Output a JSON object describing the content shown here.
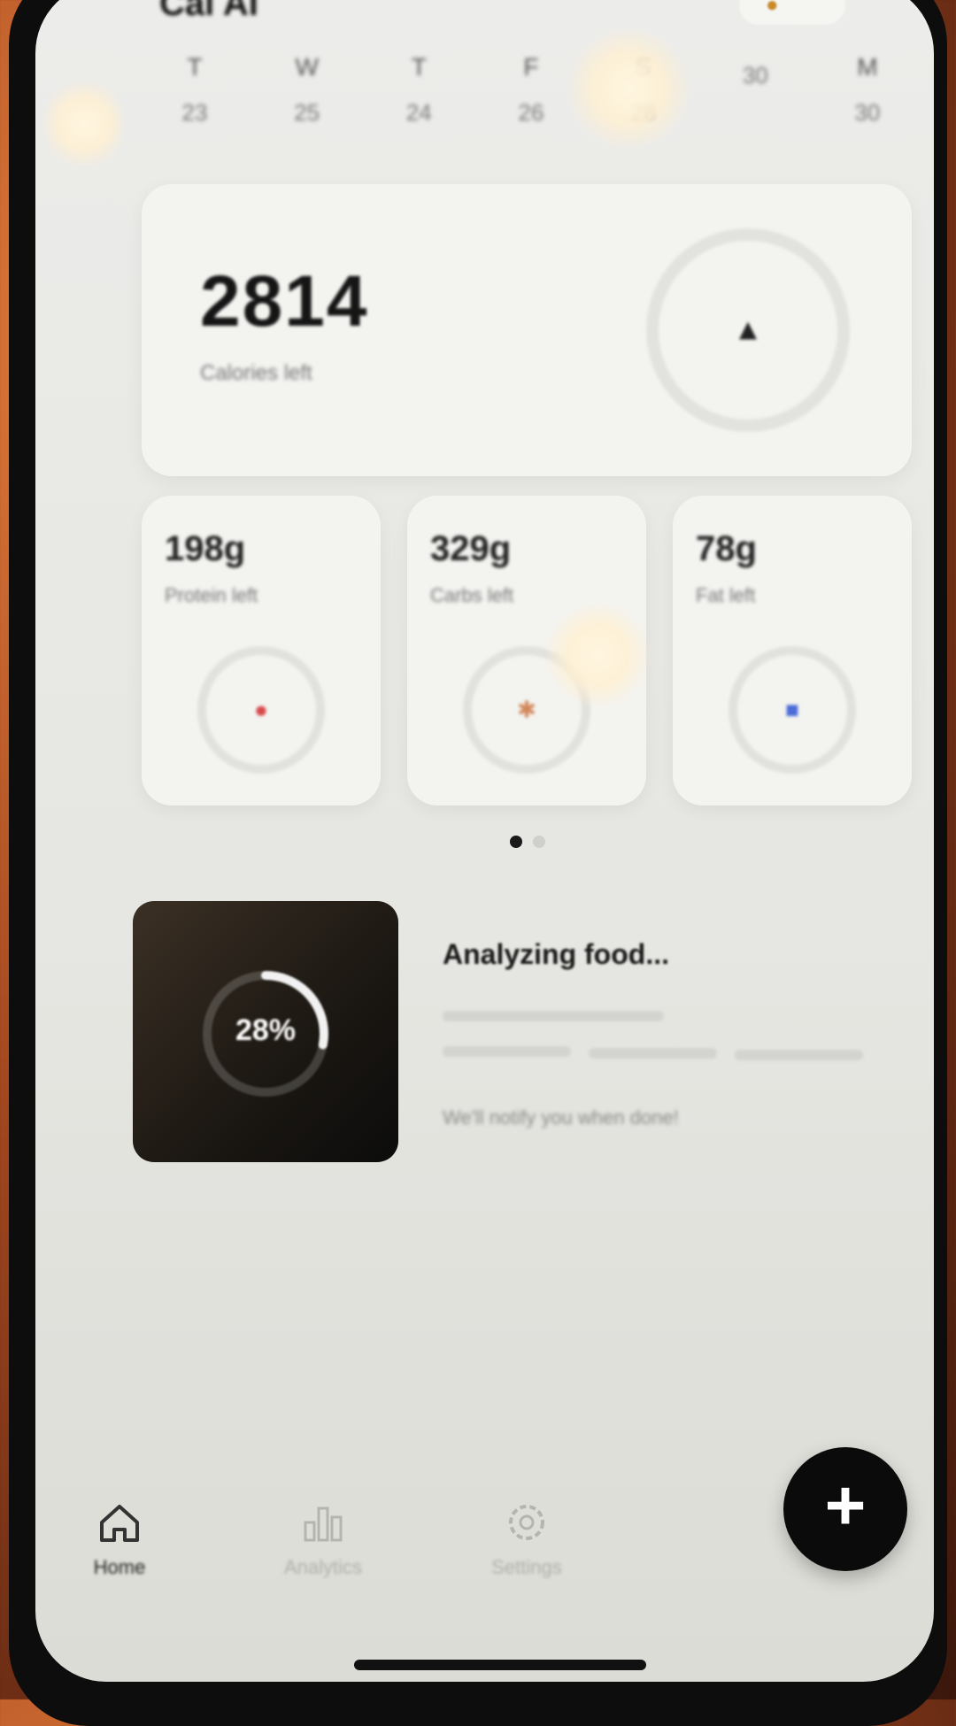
{
  "header": {
    "app_title": "Cal AI",
    "streak_count": ""
  },
  "week": {
    "days": [
      {
        "letter": "T",
        "num": "23"
      },
      {
        "letter": "W",
        "num": "25"
      },
      {
        "letter": "T",
        "num": "24"
      },
      {
        "letter": "F",
        "num": "26"
      },
      {
        "letter": "S",
        "num": "28"
      },
      {
        "letter": "",
        "num": "30"
      },
      {
        "letter": "M",
        "num": "30"
      }
    ]
  },
  "calories": {
    "value": "2814",
    "label": "Calories left"
  },
  "macros": [
    {
      "value": "198g",
      "label": "Protein left",
      "icon": "drumstick-icon",
      "color": "#d84a4a"
    },
    {
      "value": "329g",
      "label": "Carbs left",
      "icon": "wheat-icon",
      "color": "#d3875a"
    },
    {
      "value": "78g",
      "label": "Fat left",
      "icon": "droplet-icon",
      "color": "#4a6bd8"
    }
  ],
  "pager": {
    "active_index": 0,
    "count": 2
  },
  "analysis": {
    "progress_text": "28%",
    "progress_fraction": 0.28,
    "title": "Analyzing food...",
    "note": "We'll notify you when done!"
  },
  "tabs": [
    {
      "label": "Home",
      "icon": "home-icon",
      "active": true
    },
    {
      "label": "Analytics",
      "icon": "bar-chart-icon",
      "active": false
    },
    {
      "label": "Settings",
      "icon": "gear-icon",
      "active": false
    }
  ],
  "fab": {
    "icon": "plus-icon",
    "symbol": "+"
  }
}
